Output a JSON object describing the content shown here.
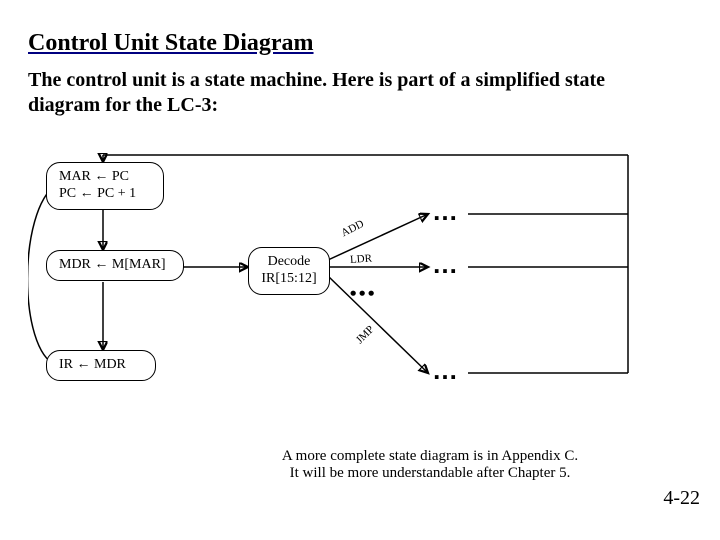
{
  "title": "Control Unit State Diagram",
  "body": "The control unit is a state machine.  Here is part of a simplified state diagram for the LC-3:",
  "caption_line1": "A more complete state diagram is in Appendix C.",
  "caption_line2": "It will be more understandable after Chapter 5.",
  "pagenum": "4-22",
  "diagram": {
    "nodes": {
      "s1_line1": "MAR ← PC",
      "s1_line2": "PC ← PC + 1",
      "s2": "MDR ← M[MAR]",
      "s3": "IR ← MDR",
      "decode_line1": "Decode",
      "decode_line2": "IR[15:12]"
    },
    "edge_labels": {
      "add": "ADD",
      "ldr": "LDR",
      "jmp": "JMP"
    },
    "ellipsis": "…"
  }
}
